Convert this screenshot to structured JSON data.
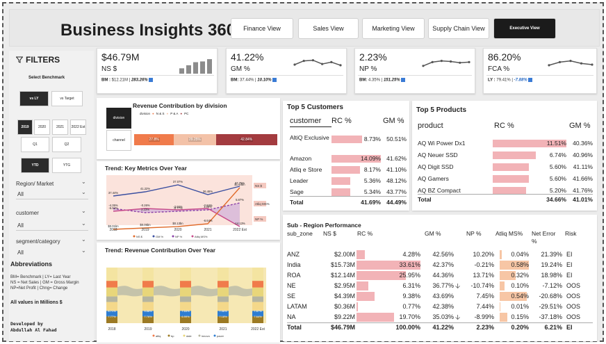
{
  "header": {
    "title": "Business Insights 360",
    "tabs": [
      "Finance View",
      "Sales View",
      "Marketing View",
      "Supply Chain View",
      "Executive View"
    ],
    "active_tab": "Executive View"
  },
  "sidebar": {
    "filters_label": "FILTERS",
    "select_benchmark": "Select Benchmark",
    "benchmark_options": [
      "vs LY",
      "vs Target"
    ],
    "years": [
      "2019",
      "2020",
      "2021",
      "2022 Est"
    ],
    "quarters": [
      "Q1",
      "Q2"
    ],
    "periods": [
      "YTD",
      "YTG"
    ],
    "region_label": "Region/ Market",
    "region_value": "All",
    "customer_label": "customer",
    "customer_value": "All",
    "segment_label": "segment/category",
    "segment_value": "All",
    "abbr_title": "Abbreviations",
    "abbr_lines": [
      "BM= Benchmark | LY= Last Year",
      "NS = Net Sales | GM = Gross Margin",
      "NP=Net Profit | Chng= Change"
    ],
    "millions_note": "All values in Millions $",
    "dev_label": "Developed by",
    "dev_name": "Abdullah Al Fahad"
  },
  "kpis": [
    {
      "value": "$46.79M",
      "label": "NS $",
      "bm_prefix": "BM :",
      "bm_value": "$12.21M",
      "chg": "283.26%"
    },
    {
      "value": "41.22%",
      "label": "GM %",
      "bm_prefix": "BM:",
      "bm_value": "37.44%",
      "chg": "10.10%"
    },
    {
      "value": "2.23%",
      "label": "NP %",
      "bm_prefix": "BM:",
      "bm_value": "4.35%",
      "chg": "151.25%"
    },
    {
      "value": "86.20%",
      "label": "FCA %",
      "bm_prefix": "LY :",
      "bm_value": "79.41%",
      "chg": "-7.88%"
    }
  ],
  "kpi_spark": {
    "ns_bars": [
      0.35,
      0.55,
      0.75,
      0.8,
      0.95
    ],
    "gm_line": [
      0.5,
      0.2,
      0.15,
      0.45,
      0.3,
      0.55
    ],
    "np_line": [
      0.6,
      0.3,
      0.2,
      0.25,
      0.35,
      0.3
    ],
    "fca_line": [
      0.55,
      0.3,
      0.2,
      0.4,
      0.5
    ]
  },
  "revenue_division": {
    "title": "Revenue Contribution by division",
    "legend_label": "division",
    "legend_items": [
      "N & S",
      "P & A",
      "PC"
    ],
    "colors": [
      "#f07b4b",
      "#f3c2a8",
      "#a33b3f"
    ],
    "row_labels": [
      "division",
      "channel"
    ],
    "segments": [
      {
        "label": "27.8%",
        "value": 27.8
      },
      {
        "label": "29.25%",
        "value": 29.25
      },
      {
        "label": "42.84%",
        "value": 42.95
      }
    ]
  },
  "trend_metrics": {
    "title": "Trend: Key Metrics Over Year",
    "years": [
      "2018",
      "2019",
      "2020",
      "2021",
      "2022 Est"
    ],
    "gm_labels": [
      "37.44%",
      "41.22%",
      "37.07%",
      "36.46%",
      "37.75%"
    ],
    "np_labels": [
      "-4.35%",
      "2.23%",
      "-0.77%",
      "1.06%",
      "5.87%"
    ],
    "atliq_labels": [
      "-6.04%",
      "-0.26%",
      "-3.66%",
      "-2.84%",
      "-14.13%"
    ],
    "ns_labels": [
      "$0.01bn",
      "$0.05bn",
      "$0.13bn",
      "-6.64%",
      "$1.64bn"
    ],
    "legend": [
      "NS $",
      "GM %",
      "NP %",
      "Atliq MS%"
    ],
    "right_labels": [
      "NS $",
      "Atliq MS%",
      "NP %"
    ]
  },
  "trend_revenue": {
    "title": "Trend: Revenue Contribution Over Year",
    "years": [
      "2018",
      "2019",
      "2020",
      "2021",
      "2022 Est"
    ],
    "labels_row1": [
      "8.71%",
      "9.88%",
      "7.64%",
      "7.56%",
      "7.87%"
    ],
    "labels_row2": [
      "7.77%",
      "7.76%",
      "6.99%",
      "7.18%",
      "7.64%"
    ],
    "legend": [
      "atliq",
      "bp",
      "dale",
      "innovo",
      "pacer"
    ]
  },
  "top_customers": {
    "title": "Top 5 Customers",
    "headers": [
      "customer",
      "RC %",
      "GM %"
    ],
    "rows": [
      {
        "name": "AltiQ Exclusive",
        "rc": "8.73%",
        "gm": "50.51%",
        "rc_val": 8.73
      },
      {
        "name": "Amazon",
        "rc": "14.09%",
        "gm": "41.62%",
        "rc_val": 14.09
      },
      {
        "name": "Atliq e Store",
        "rc": "8.17%",
        "gm": "41.10%",
        "rc_val": 8.17
      },
      {
        "name": "Leader",
        "rc": "5.36%",
        "gm": "48.12%",
        "rc_val": 5.36
      },
      {
        "name": "Sage",
        "rc": "5.34%",
        "gm": "43.77%",
        "rc_val": 5.34
      }
    ],
    "total": {
      "name": "Total",
      "rc": "41.69%",
      "gm": "44.49%"
    }
  },
  "top_products": {
    "title": "Top 5 Products",
    "headers": [
      "product",
      "RC %",
      "GM %"
    ],
    "rows": [
      {
        "name": "AQ Wi Power Dx1",
        "rc": "11.51%",
        "gm": "40.36%",
        "rc_val": 11.51
      },
      {
        "name": "AQ Neuer SSD",
        "rc": "6.74%",
        "gm": "40.96%",
        "rc_val": 6.74
      },
      {
        "name": "AQ Digit SSD",
        "rc": "5.60%",
        "gm": "41.11%",
        "rc_val": 5.6
      },
      {
        "name": "AQ Gamers",
        "rc": "5.60%",
        "gm": "41.66%",
        "rc_val": 5.6
      },
      {
        "name": "AQ BZ Compact",
        "rc": "5.20%",
        "gm": "41.76%",
        "rc_val": 5.2
      }
    ],
    "total": {
      "name": "Total",
      "rc": "34.66%",
      "gm": "41.01%"
    }
  },
  "subregion": {
    "title": "Sub - Region Performance",
    "headers": [
      "sub_zone",
      "NS $",
      "RC %",
      "GM %",
      "NP %",
      "Atliq MS%",
      "Net Error %",
      "Risk"
    ],
    "rows": [
      {
        "zone": "ANZ",
        "ns": "$2.00M",
        "rc": "4.28%",
        "gm": "42.56%",
        "np": "10.20%",
        "ms": "0.04%",
        "ne": "21.39%",
        "risk": "EI",
        "rc_val": 4.28,
        "ms_val": 0.04,
        "arrow": false
      },
      {
        "zone": "India",
        "ns": "$15.73M",
        "rc": "33.61%",
        "gm": "42.37%",
        "np": "-0.21%",
        "ms": "0.58%",
        "ne": "19.24%",
        "risk": "EI",
        "rc_val": 33.61,
        "ms_val": 0.58,
        "arrow": false
      },
      {
        "zone": "ROA",
        "ns": "$12.14M",
        "rc": "25.95%",
        "gm": "44.36%",
        "np": "13.71%",
        "ms": "0.32%",
        "ne": "18.98%",
        "risk": "EI",
        "rc_val": 25.95,
        "ms_val": 0.32,
        "arrow": false
      },
      {
        "zone": "NE",
        "ns": "$2.95M",
        "rc": "6.31%",
        "gm": "36.77%",
        "np": "-10.74%",
        "ms": "0.10%",
        "ne": "-7.12%",
        "risk": "OOS",
        "rc_val": 6.31,
        "ms_val": 0.1,
        "arrow": true
      },
      {
        "zone": "SE",
        "ns": "$4.39M",
        "rc": "9.38%",
        "gm": "43.69%",
        "np": "7.45%",
        "ms": "0.54%",
        "ne": "-20.68%",
        "risk": "OOS",
        "rc_val": 9.38,
        "ms_val": 0.54,
        "arrow": false
      },
      {
        "zone": "LATAM",
        "ns": "$0.36M",
        "rc": "0.77%",
        "gm": "42.38%",
        "np": "7.44%",
        "ms": "0.01%",
        "ne": "-29.51%",
        "risk": "OOS",
        "rc_val": 0.77,
        "ms_val": 0.01,
        "arrow": false
      },
      {
        "zone": "NA",
        "ns": "$9.22M",
        "rc": "19.70%",
        "gm": "35.03%",
        "np": "-8.99%",
        "ms": "0.15%",
        "ne": "-37.18%",
        "risk": "OOS",
        "rc_val": 19.7,
        "ms_val": 0.15,
        "arrow": true
      }
    ],
    "total": {
      "zone": "Total",
      "ns": "$46.79M",
      "rc": "100.00%",
      "gm": "41.22%",
      "np": "2.23%",
      "ms": "0.20%",
      "ne": "6.21%",
      "risk": "EI"
    }
  }
}
